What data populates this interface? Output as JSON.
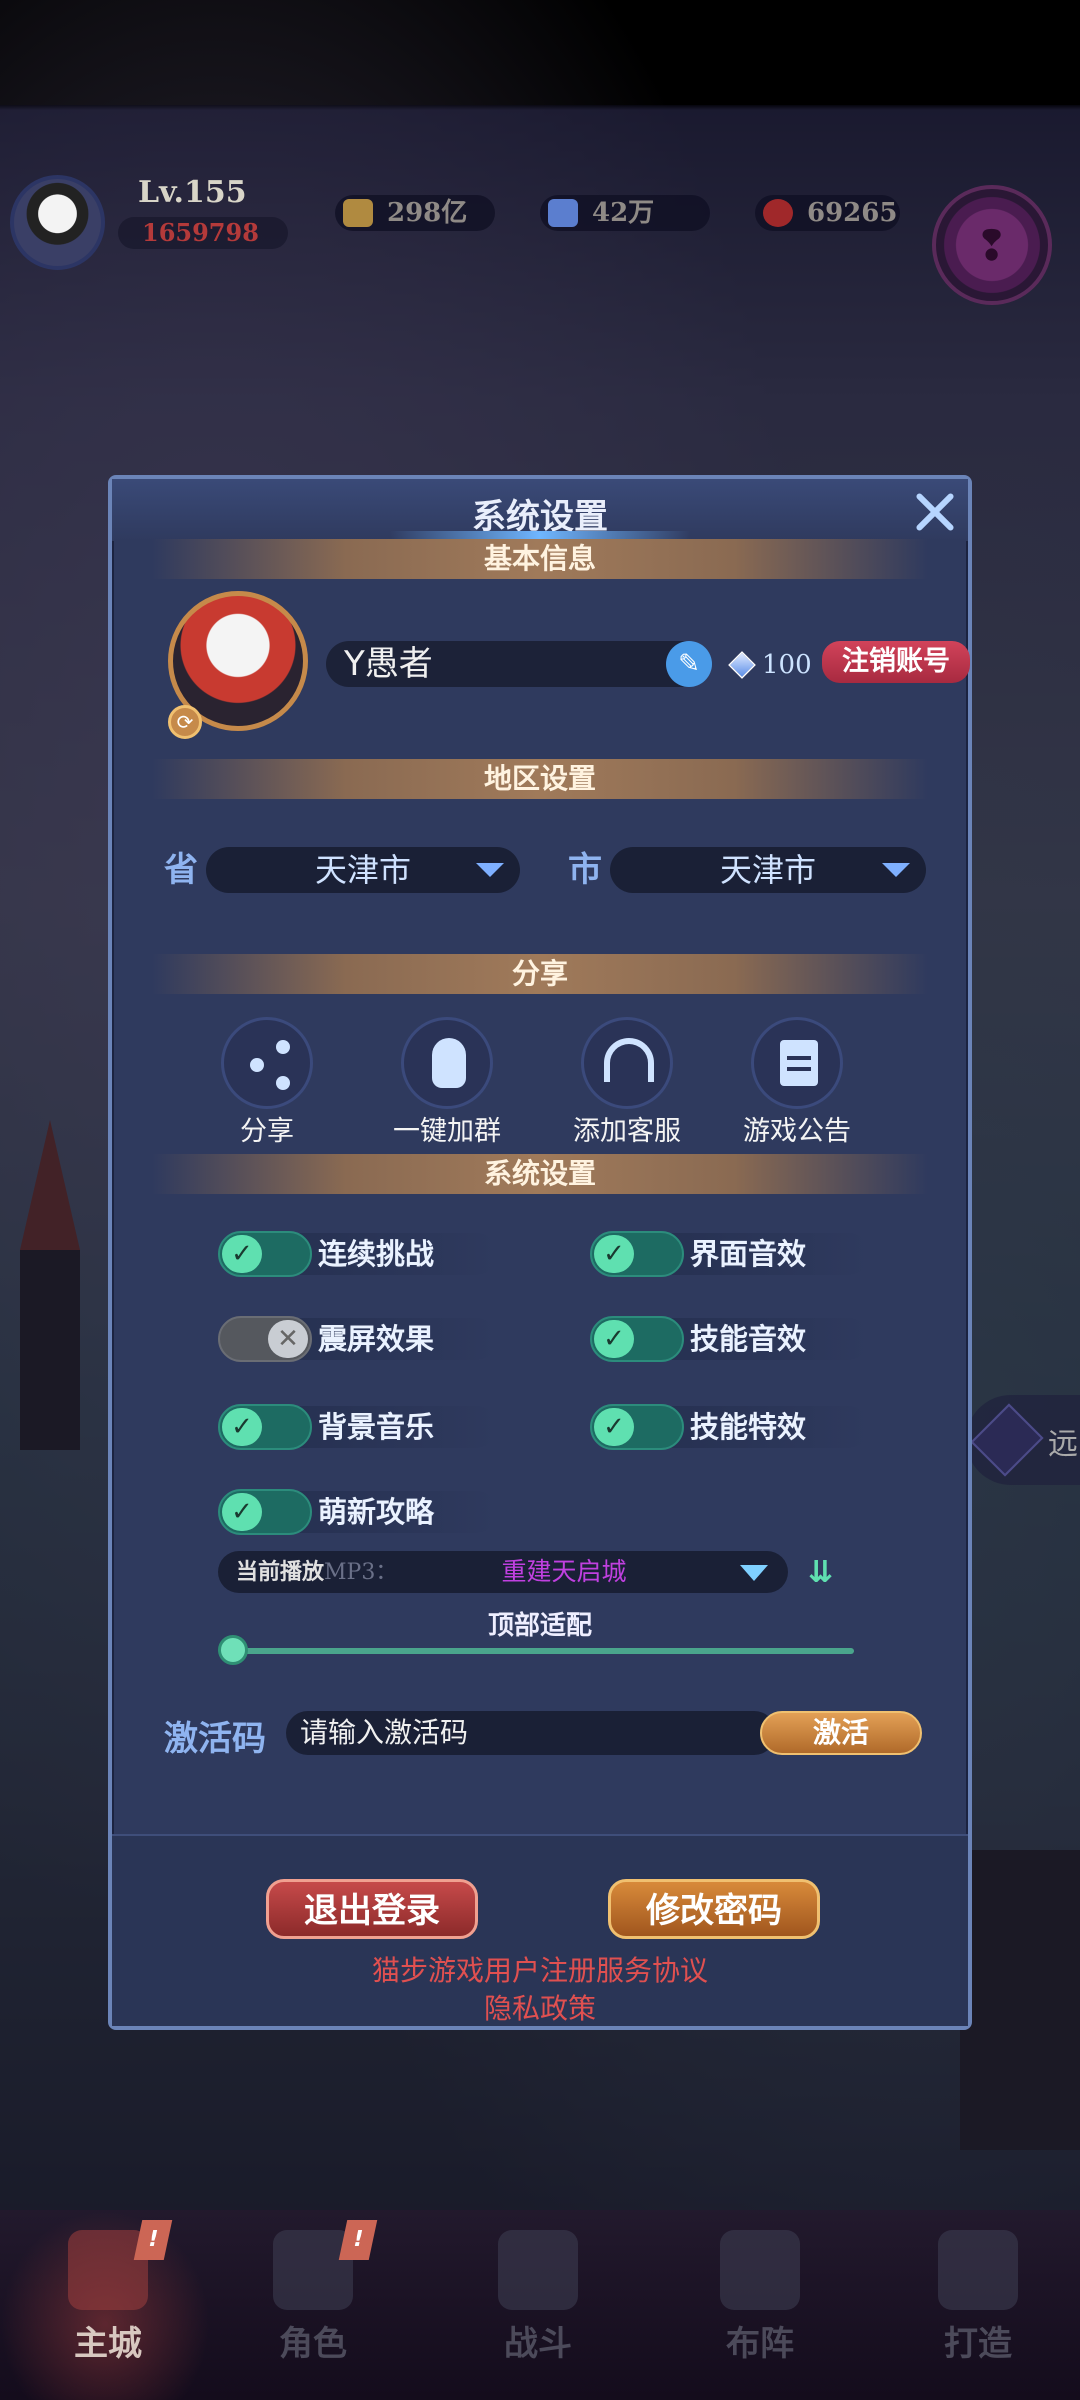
{
  "hud": {
    "level": "Lv.155",
    "power": "1659798",
    "gold": "298亿",
    "diamond": "42万",
    "ruby": "69265"
  },
  "side_button": {
    "label": "远"
  },
  "dialog": {
    "title": "系统设置",
    "sections": {
      "basic_info": "基本信息",
      "region": "地区设置",
      "share": "分享",
      "system": "系统设置"
    },
    "profile": {
      "name": "Y愚者",
      "gems": "100",
      "cancel_account": "注销账号"
    },
    "region": {
      "province_label": "省",
      "province_value": "天津市",
      "city_label": "市",
      "city_value": "天津市"
    },
    "share_items": [
      {
        "label": "分享",
        "icon": "share-icon"
      },
      {
        "label": "一键加群",
        "icon": "qq-icon"
      },
      {
        "label": "添加客服",
        "icon": "headset-icon"
      },
      {
        "label": "游戏公告",
        "icon": "notice-icon"
      }
    ],
    "toggles": [
      {
        "label": "连续挑战",
        "on": true
      },
      {
        "label": "界面音效",
        "on": true
      },
      {
        "label": "震屏效果",
        "on": false
      },
      {
        "label": "技能音效",
        "on": true
      },
      {
        "label": "背景音乐",
        "on": true
      },
      {
        "label": "技能特效",
        "on": true
      },
      {
        "label": "萌新攻略",
        "on": true
      }
    ],
    "music": {
      "label": "当前播放",
      "label_sub": "MP3：",
      "song": "重建天启城"
    },
    "slider": {
      "label": "顶部适配",
      "value": 0
    },
    "activation": {
      "label": "激活码",
      "placeholder": "请输入激活码",
      "button": "激活"
    },
    "footer": {
      "logout": "退出登录",
      "change_password": "修改密码",
      "agreement_link": "猫步游戏用户注册服务协议",
      "privacy_link": "隐私政策"
    }
  },
  "bottom_nav": [
    {
      "label": "主城",
      "active": true,
      "badge": "!"
    },
    {
      "label": "角色",
      "active": false,
      "badge": "!"
    },
    {
      "label": "战斗",
      "active": false
    },
    {
      "label": "布阵",
      "active": false
    },
    {
      "label": "打造",
      "active": false
    }
  ],
  "colors": {
    "dialog_bg": "#2f3a5e",
    "toggle_on": "#5fe0b0",
    "accent_red": "#e05050",
    "accent_orange": "#d88a3a"
  }
}
